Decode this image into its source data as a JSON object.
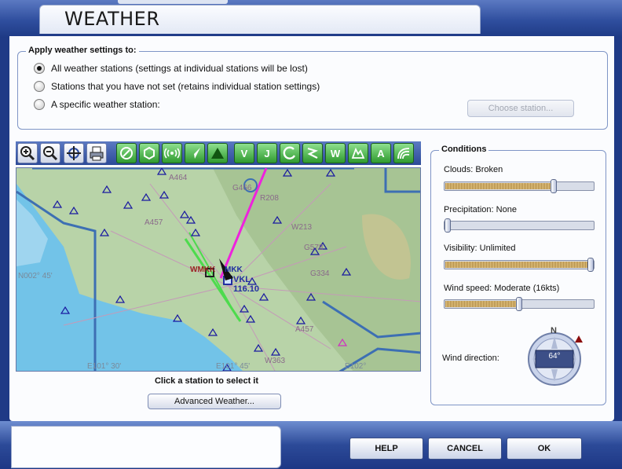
{
  "window": {
    "title": "WEATHER"
  },
  "apply_group": {
    "title": "Apply weather settings to:",
    "options": [
      {
        "label": "All weather stations (settings at individual stations will be lost)",
        "checked": true
      },
      {
        "label": "Stations that you have not set (retains individual station settings)",
        "checked": false
      },
      {
        "label": "A specific weather station:",
        "checked": false
      }
    ],
    "choose_station_label": "Choose station..."
  },
  "toolbar": {
    "zoom_in": "zoom-in-icon",
    "zoom_out": "zoom-out-icon",
    "center": "center-aircraft-icon",
    "print": "print-icon",
    "filters": [
      "airport-icon",
      "vor-icon",
      "ndb-icon",
      "airway-icon",
      "intersection-icon",
      "V",
      "J",
      "approach-icon",
      "route-icon",
      "W",
      "terrain-icon",
      "A",
      "wind-icon"
    ]
  },
  "map": {
    "labels": {
      "l1": "A464",
      "l2": "G466",
      "l3": "R208",
      "l4": "A457",
      "l5": "W213",
      "l6": "G578",
      "l7": "WMKK",
      "l8": "MKK",
      "l9": "VKL",
      "l10": "116.10",
      "l11": "G334",
      "l12": "N002° 45'",
      "l13": "A457",
      "l14": "E101° 30'",
      "l15": "E101° 45'",
      "l16": "W363",
      "l17": "E102°"
    }
  },
  "caption": "Click a station to select it",
  "advanced_label": "Advanced Weather...",
  "conditions": {
    "title": "Conditions",
    "items": [
      {
        "label": "Clouds: Broken",
        "value": 0.74
      },
      {
        "label": "Precipitation: None",
        "value": 0.0
      },
      {
        "label": "Visibility: Unlimited",
        "value": 1.0
      },
      {
        "label": "Wind speed: Moderate (16kts)",
        "value": 0.5
      }
    ],
    "wind_direction_label": "Wind direction:",
    "wind_direction_value": "64°",
    "compass_north": "N"
  },
  "footer": {
    "help": "HELP",
    "cancel": "CANCEL",
    "ok": "OK"
  },
  "colors": {
    "ocean": "#72c3e8",
    "land": "#b8d3a8",
    "airway": "#ee22dd",
    "runway": "#4ddb4d",
    "boundary": "#3d6fb3"
  }
}
